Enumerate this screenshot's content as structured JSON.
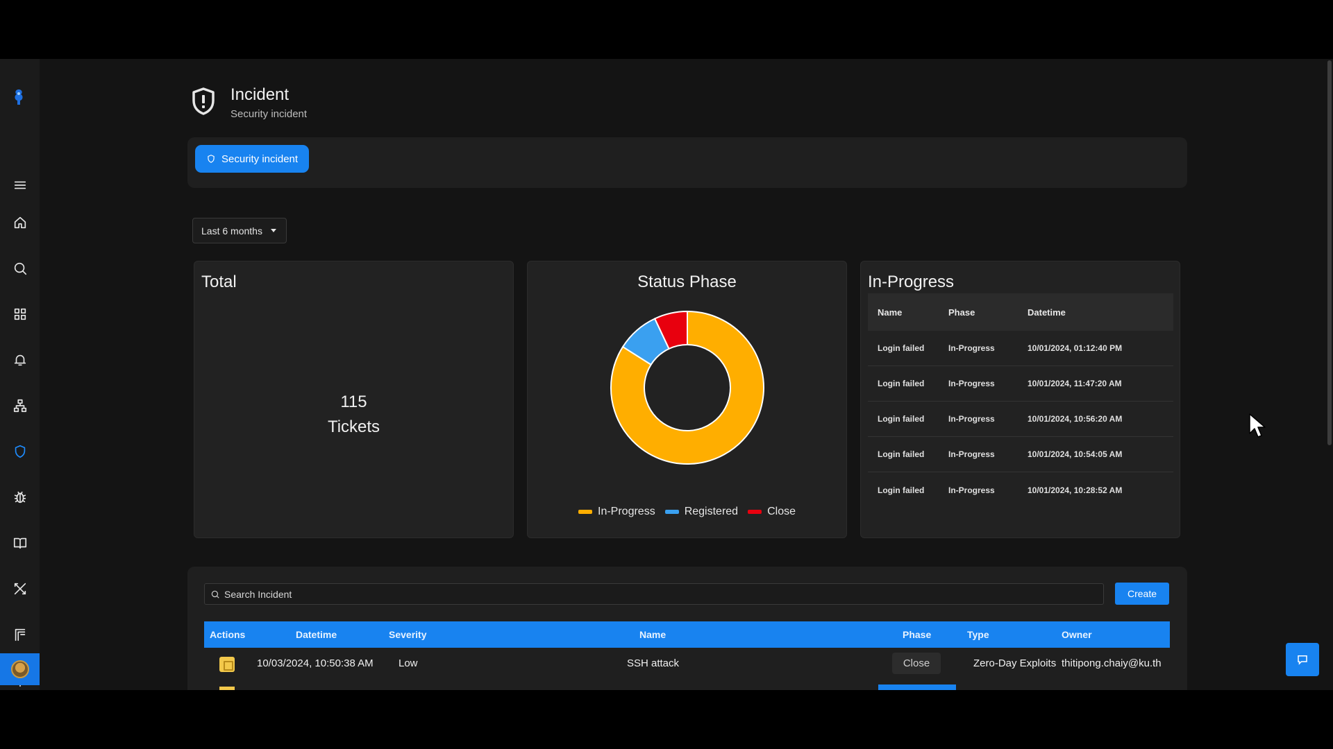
{
  "page": {
    "title": "Incident",
    "subtitle": "Security incident"
  },
  "tabs": [
    {
      "label": "Security incident",
      "active": true
    }
  ],
  "filter": {
    "range_label": "Last 6 months"
  },
  "total_card": {
    "title": "Total",
    "count": "115",
    "unit": "Tickets"
  },
  "status_card": {
    "title": "Status Phase",
    "legend": [
      {
        "label": "In-Progress",
        "color": "#ffae00"
      },
      {
        "label": "Registered",
        "color": "#3aa0f0"
      },
      {
        "label": "Close",
        "color": "#e8000e"
      }
    ]
  },
  "chart_data": {
    "type": "pie",
    "title": "Status Phase",
    "categories": [
      "In-Progress",
      "Registered",
      "Close"
    ],
    "values": [
      84,
      9,
      7
    ],
    "colors": [
      "#ffae00",
      "#3aa0f0",
      "#e8000e"
    ],
    "donut": true,
    "legend_position": "bottom"
  },
  "progress_card": {
    "title": "In-Progress",
    "columns": [
      "Name",
      "Phase",
      "Datetime"
    ],
    "rows": [
      [
        "Login failed",
        "In-Progress",
        "10/01/2024, 01:12:40 PM"
      ],
      [
        "Login failed",
        "In-Progress",
        "10/01/2024, 11:47:20 AM"
      ],
      [
        "Login failed",
        "In-Progress",
        "10/01/2024, 10:56:20 AM"
      ],
      [
        "Login failed",
        "In-Progress",
        "10/01/2024, 10:54:05 AM"
      ],
      [
        "Login failed",
        "In-Progress",
        "10/01/2024, 10:28:52 AM"
      ]
    ]
  },
  "incident_list": {
    "search_placeholder": "Search Incident",
    "create_label": "Create",
    "columns": [
      "Actions",
      "Datetime",
      "Severity",
      "Name",
      "Phase",
      "Type",
      "Owner"
    ],
    "rows": [
      {
        "datetime": "10/03/2024, 10:50:38 AM",
        "severity": "Low",
        "name": "SSH attack",
        "phase": "Close",
        "type": "Zero-Day Exploits",
        "owner": "thitipong.chaiy@ku.th"
      }
    ]
  },
  "sidebar": {
    "items": [
      {
        "icon": "menu-icon"
      },
      {
        "icon": "home-icon"
      },
      {
        "icon": "search-icon"
      },
      {
        "icon": "grid-icon"
      },
      {
        "icon": "bell-icon"
      },
      {
        "icon": "network-icon"
      },
      {
        "icon": "shield-icon",
        "active": true
      },
      {
        "icon": "bug-icon"
      },
      {
        "icon": "book-icon"
      },
      {
        "icon": "tools-icon"
      },
      {
        "icon": "flow-icon"
      },
      {
        "icon": "gear-icon"
      }
    ]
  },
  "colors": {
    "accent": "#1883f0",
    "in_progress": "#ffae00",
    "registered": "#3aa0f0",
    "close": "#e8000e"
  }
}
